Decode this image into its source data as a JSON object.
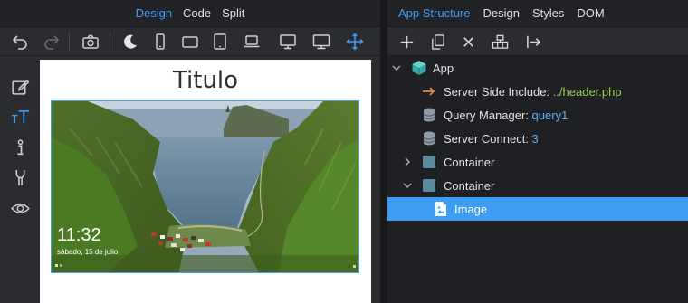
{
  "left_tabs": [
    "Design",
    "Code",
    "Split"
  ],
  "active_left_tab": "Design",
  "left_toolbar_icons": [
    "undo-icon",
    "redo-icon",
    "camera-icon",
    "dark-mode-icon",
    "phone-portrait-icon",
    "phone-landscape-icon",
    "tablet-portrait-icon",
    "laptop-icon",
    "desktop-icon",
    "monitor-icon",
    "move-icon"
  ],
  "side_tool_icons": [
    "edit-icon",
    "text-size-icon",
    "info-icon",
    "wrench-icon",
    "eye-icon"
  ],
  "canvas": {
    "heading": "Titulo",
    "lock_time": "11:32",
    "lock_date": "sábado, 15 de julio"
  },
  "right_tabs": [
    "App Structure",
    "Design",
    "Styles",
    "DOM"
  ],
  "active_right_tab": "App Structure",
  "right_toolbar_icons": [
    "add-icon",
    "duplicate-icon",
    "delete-icon",
    "structure-icon",
    "export-icon"
  ],
  "tree": {
    "app": "App",
    "ssi_label": "Server Side Include: ",
    "ssi_value": "../header.php",
    "qm_label": "Query Manager: ",
    "qm_value": "query1",
    "sc_label": "Server Connect: ",
    "sc_value": "3",
    "container1": "Container",
    "container2": "Container",
    "image": "Image"
  },
  "colors": {
    "accent": "#3d9df3",
    "value_green": "#9acd5a",
    "value_blue": "#5aaef7",
    "app_icon": "#4db3b3",
    "include_arrow": "#d9884a"
  }
}
